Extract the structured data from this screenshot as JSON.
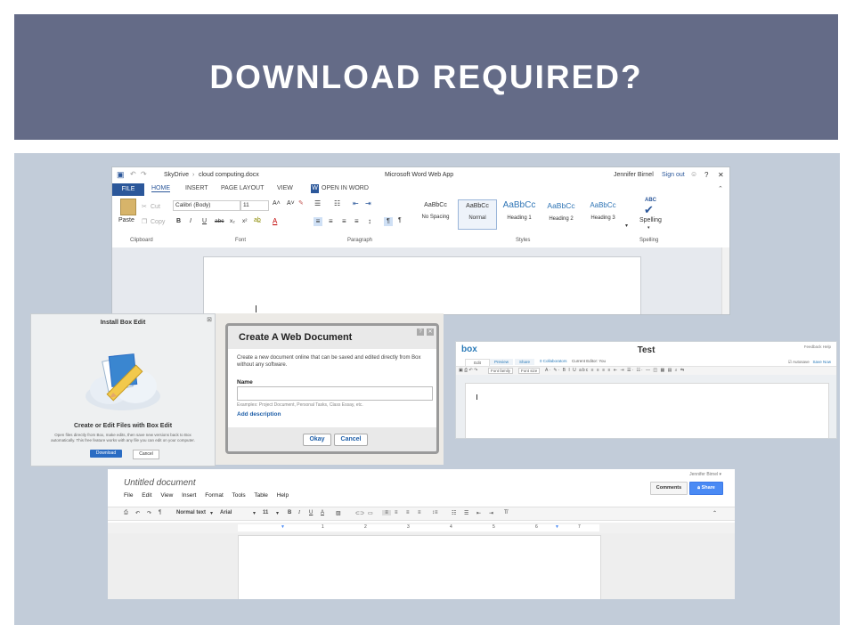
{
  "slide": {
    "title": "DOWNLOAD REQUIRED?"
  },
  "colors": {
    "header_band": "#646b87",
    "collage_background": "#c2ccd9",
    "word_blue": "#2b579a",
    "box_blue": "#2a6cc3",
    "google_share_blue": "#4a8af4"
  },
  "word": {
    "breadcrumb_root": "SkyDrive",
    "breadcrumb_sep": "›",
    "breadcrumb_file": "cloud computing.docx",
    "app_title": "Microsoft Word Web App",
    "user": "Jennifer Birnel",
    "sign_out": "Sign out",
    "help": "?",
    "close": "✕",
    "tabs": {
      "file": "FILE",
      "home": "HOME",
      "insert": "INSERT",
      "page_layout": "PAGE LAYOUT",
      "view": "VIEW",
      "open_in_word": "OPEN IN WORD"
    },
    "clipboard": {
      "paste": "Paste",
      "cut": "Cut",
      "copy": "Copy",
      "label": "Clipboard"
    },
    "font": {
      "family": "Calibri (Body)",
      "size": "11",
      "label": "Font"
    },
    "paragraph_label": "Paragraph",
    "styles": {
      "label": "Styles",
      "items": [
        {
          "preview": "AaBbCc",
          "name": "No Spacing"
        },
        {
          "preview": "AaBbCc",
          "name": "Normal"
        },
        {
          "preview": "AaBbCc",
          "name": "Heading 1"
        },
        {
          "preview": "AaBbCc",
          "name": "Heading 2"
        },
        {
          "preview": "AaBbCc",
          "name": "Heading 3"
        }
      ]
    },
    "spelling": {
      "abc": "ABC",
      "check": "✔",
      "button": "Spelling",
      "label": "Spelling"
    }
  },
  "box_edit": {
    "title": "Install Box Edit",
    "close": "⊠",
    "heading": "Create or Edit Files with Box Edit",
    "description": "Open files directly from Box, make edits, then save new versions back to Box automatically. This free feature works with any file you can edit on your computer.",
    "download": "Download",
    "cancel": "Cancel"
  },
  "web_document": {
    "title": "Create A Web Document",
    "help": "?",
    "close": "✕",
    "description": "Create a new document online that can be saved and edited directly from Box without any software.",
    "name_label": "Name",
    "name_value": "",
    "examples": "Examples: Project Document, Personal Tasks, Class Essay, etc.",
    "add_description": "Add description",
    "okay": "Okay",
    "cancel": "Cancel"
  },
  "box_online": {
    "logo": "box",
    "title": "Test",
    "feedback": "Feedback  Help",
    "tabs": [
      "Edit",
      "Preview",
      "Share"
    ],
    "collaborators": "0 Collaborators",
    "current_editor": "Current Editor: You",
    "autosave": "Autosave",
    "save_now": "Save Now",
    "font_family": "Font family",
    "font_size": "Font size"
  },
  "google_docs": {
    "title": "Untitled document",
    "user": "Jennifer Birnel ▾",
    "menu": [
      "File",
      "Edit",
      "View",
      "Insert",
      "Format",
      "Tools",
      "Table",
      "Help"
    ],
    "comments": "Comments",
    "share": "Share",
    "style": "Normal text",
    "font": "Arial",
    "size": "11",
    "ruler_numbers": [
      "1",
      "2",
      "3",
      "4",
      "5",
      "6",
      "7"
    ]
  }
}
